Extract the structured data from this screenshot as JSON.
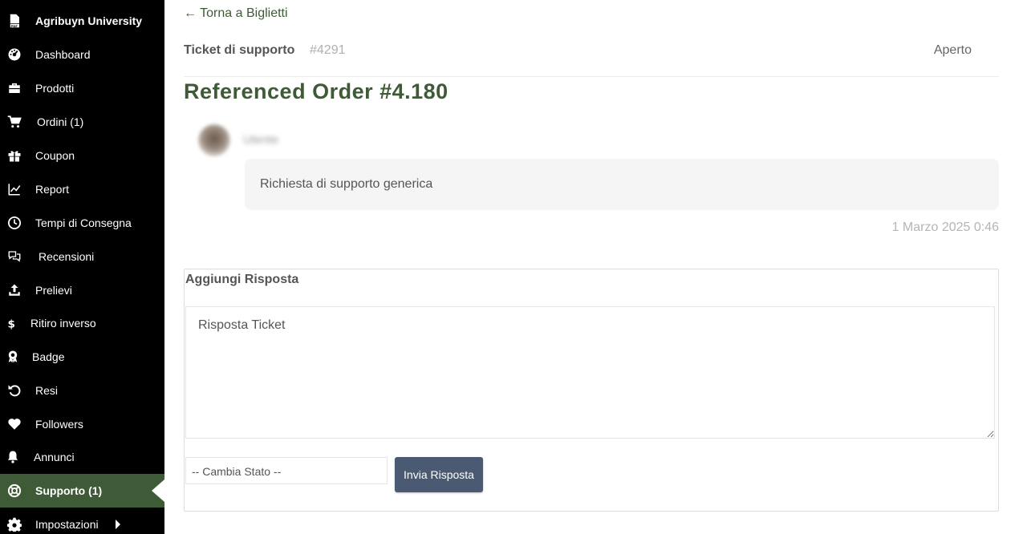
{
  "sidebar": {
    "items": [
      {
        "label": "Agribuyn University",
        "icon": "pdf-file-icon"
      },
      {
        "label": "Dashboard",
        "icon": "speedometer-icon"
      },
      {
        "label": "Prodotti",
        "icon": "briefcase-icon"
      },
      {
        "label": "Ordini (1)",
        "icon": "cart-icon"
      },
      {
        "label": "Coupon",
        "icon": "gift-icon"
      },
      {
        "label": "Report",
        "icon": "line-chart-icon"
      },
      {
        "label": "Tempi di Consegna",
        "icon": "clock-icon"
      },
      {
        "label": "Recensioni",
        "icon": "chat-bubbles-icon"
      },
      {
        "label": "Prelievi",
        "icon": "upload-icon"
      },
      {
        "label": "Ritiro inverso",
        "icon": "dollar-icon"
      },
      {
        "label": "Badge",
        "icon": "award-icon"
      },
      {
        "label": "Resi",
        "icon": "undo-icon"
      },
      {
        "label": "Followers",
        "icon": "heart-icon"
      },
      {
        "label": "Annunci",
        "icon": "bell-icon"
      },
      {
        "label": "Supporto (1)",
        "icon": "lifebuoy-icon"
      },
      {
        "label": "Impostazioni",
        "icon": "gear-icon"
      }
    ],
    "active_item": "Supporto (1)"
  },
  "main": {
    "back_link": "← Torna a Biglietti",
    "ticket_label": "Ticket di supporto",
    "ticket_number": "#4291",
    "ticket_status": "Aperto",
    "order_title": "Referenced Order #4.180",
    "message": {
      "author": "Utente",
      "text": "Richiesta di supporto generica",
      "timestamp": "1 Marzo 2025 0:46"
    },
    "reply": {
      "title": "Aggiungi Risposta",
      "textarea_value": "Risposta Ticket",
      "status_select_value": "-- Cambia Stato --",
      "send_label": "Invia Risposta"
    }
  },
  "colors": {
    "sidebar_bg": "#000000",
    "accent_green": "#3f5a36",
    "send_button": "#4a5a72",
    "message_bg": "#f5f5f5"
  }
}
